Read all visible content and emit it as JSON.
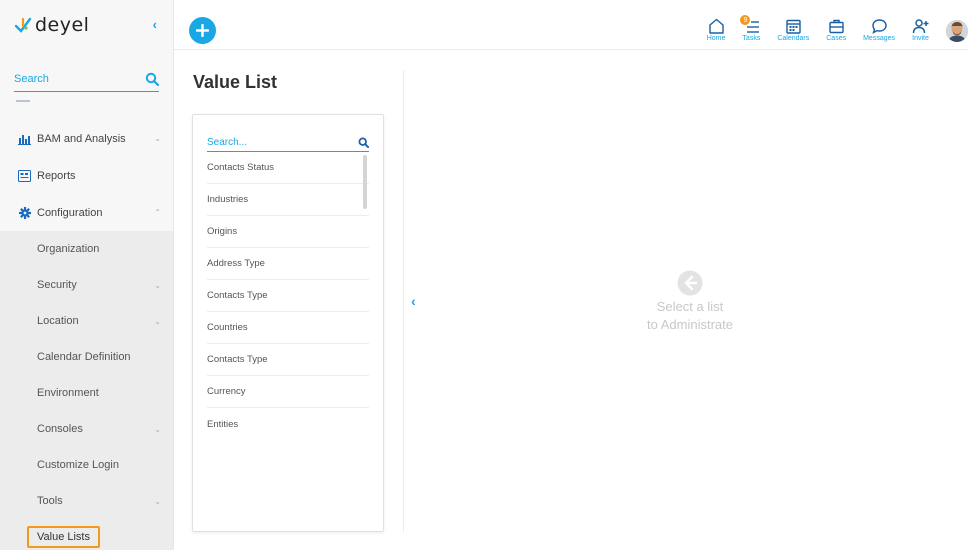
{
  "brand": {
    "name": "deyel"
  },
  "sidebar": {
    "search_placeholder": "Search",
    "items": [
      {
        "label": "BAM and Analysis",
        "icon": "bar-chart-icon",
        "expandable": true
      },
      {
        "label": "Reports",
        "icon": "report-icon",
        "expandable": false
      },
      {
        "label": "Configuration",
        "icon": "gear-icon",
        "expandable": true,
        "expanded": true
      }
    ],
    "sub_items": [
      {
        "label": "Organization",
        "expandable": false
      },
      {
        "label": "Security",
        "expandable": true
      },
      {
        "label": "Location",
        "expandable": true
      },
      {
        "label": "Calendar Definition",
        "expandable": false
      },
      {
        "label": "Environment",
        "expandable": false
      },
      {
        "label": "Consoles",
        "expandable": true
      },
      {
        "label": "Customize Login",
        "expandable": false
      },
      {
        "label": "Tools",
        "expandable": true
      },
      {
        "label": "Value Lists",
        "expandable": false,
        "active": true
      }
    ]
  },
  "topbar": {
    "nav": [
      {
        "label": "Home",
        "icon": "home-icon"
      },
      {
        "label": "Tasks",
        "icon": "tasks-icon",
        "badge": "9"
      },
      {
        "label": "Calendars",
        "icon": "calendar-icon"
      },
      {
        "label": "Cases",
        "icon": "briefcase-icon"
      },
      {
        "label": "Messages",
        "icon": "message-icon"
      },
      {
        "label": "Invite",
        "icon": "invite-icon"
      }
    ]
  },
  "main": {
    "title": "Value List",
    "list_search_placeholder": "Search...",
    "lists": [
      "Contacts Status",
      "Industries",
      "Origins",
      "Address Type",
      "Contacts Type",
      "Countries",
      "Contacts Type",
      "Currency",
      "Entities"
    ],
    "empty_state": {
      "line1": "Select a list",
      "line2": "to Administrate"
    }
  },
  "colors": {
    "accent": "#1aa7e6",
    "highlight": "#f39a1e",
    "sidebar_bg": "#f7f7f7"
  }
}
